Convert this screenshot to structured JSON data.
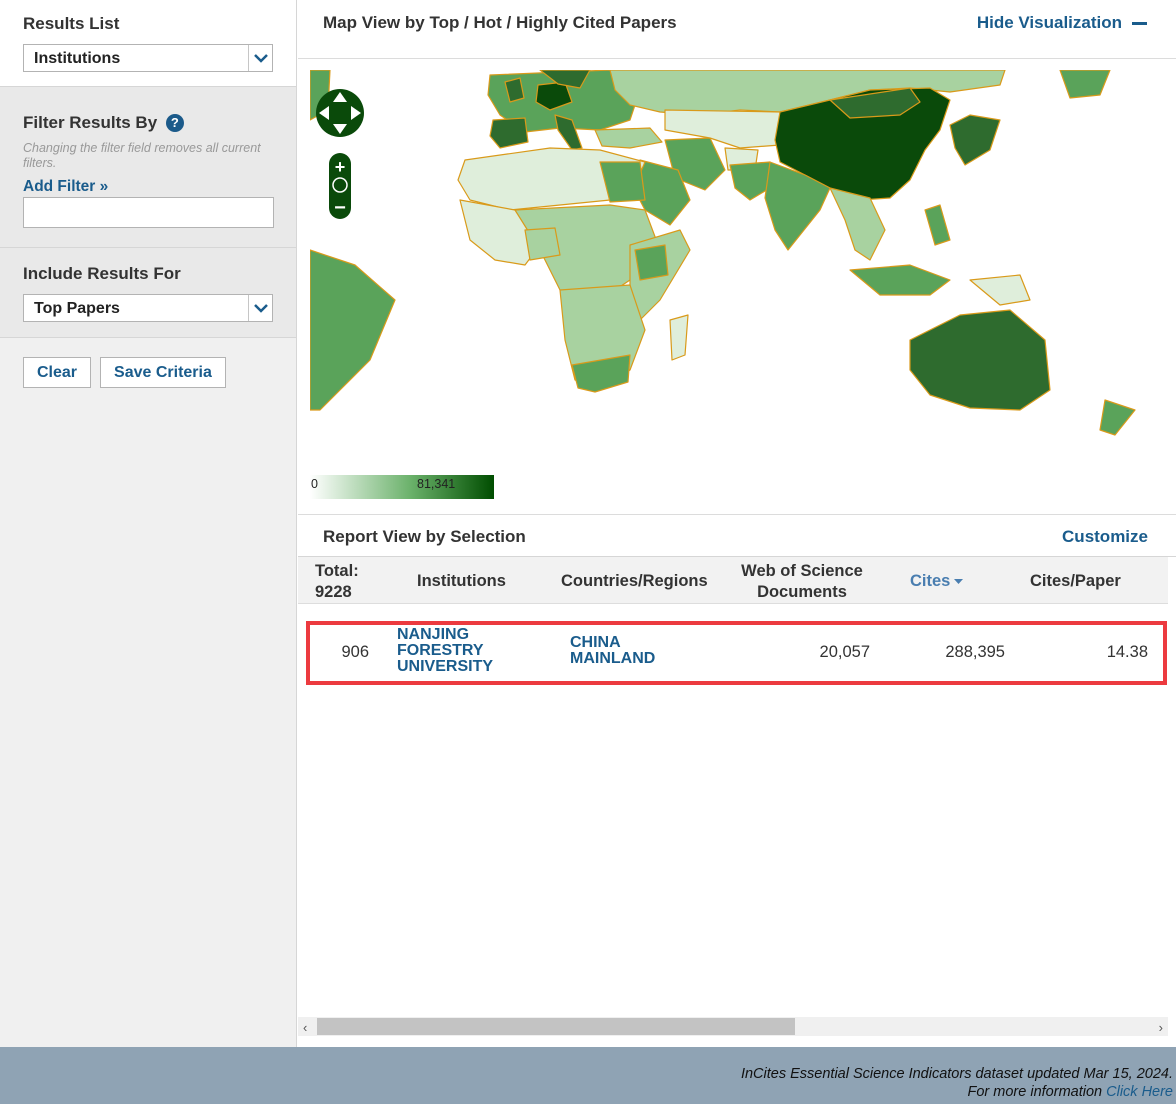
{
  "sidebar": {
    "results_list": {
      "heading": "Results List",
      "selected": "Institutions"
    },
    "filter": {
      "heading": "Filter Results By",
      "help": "?",
      "note": "Changing the filter field removes all current filters.",
      "add_filter": "Add Filter »",
      "input_value": ""
    },
    "include": {
      "heading": "Include Results For",
      "selected": "Top Papers"
    },
    "buttons": {
      "clear": "Clear",
      "save": "Save Criteria"
    }
  },
  "visualization": {
    "title": "Map View by Top / Hot / Highly Cited Papers",
    "hide_label": "Hide Visualization",
    "legend": {
      "min": "0",
      "max": "81,341",
      "color_low": "#ffffff",
      "color_high": "#004d00"
    },
    "map_colors": {
      "darkest": "#0a4a0a",
      "dark": "#2e6b2e",
      "mid": "#5aa35a",
      "light": "#a8d2a0",
      "lightest": "#dfeedb",
      "border": "#d99a1a"
    }
  },
  "report": {
    "title": "Report View by Selection",
    "customize": "Customize",
    "columns": {
      "total_label": "Total:",
      "total_value": "9228",
      "institutions": "Institutions",
      "countries": "Countries/Regions",
      "wos_docs": "Web of Science Documents",
      "cites": "Cites",
      "cites_per_paper": "Cites/Paper"
    },
    "rows": [
      {
        "rank": "906",
        "institution": "NANJING FORESTRY UNIVERSITY",
        "country": "CHINA MAINLAND",
        "wos_docs": "20,057",
        "cites": "288,395",
        "cites_per_paper": "14.38"
      }
    ],
    "highlight_color": "#ec3a3f"
  },
  "footer": {
    "dataset": "InCites Essential Science Indicators dataset updated Mar 15, 2024.",
    "more_info": "For more information ",
    "click_here": "Click Here"
  }
}
